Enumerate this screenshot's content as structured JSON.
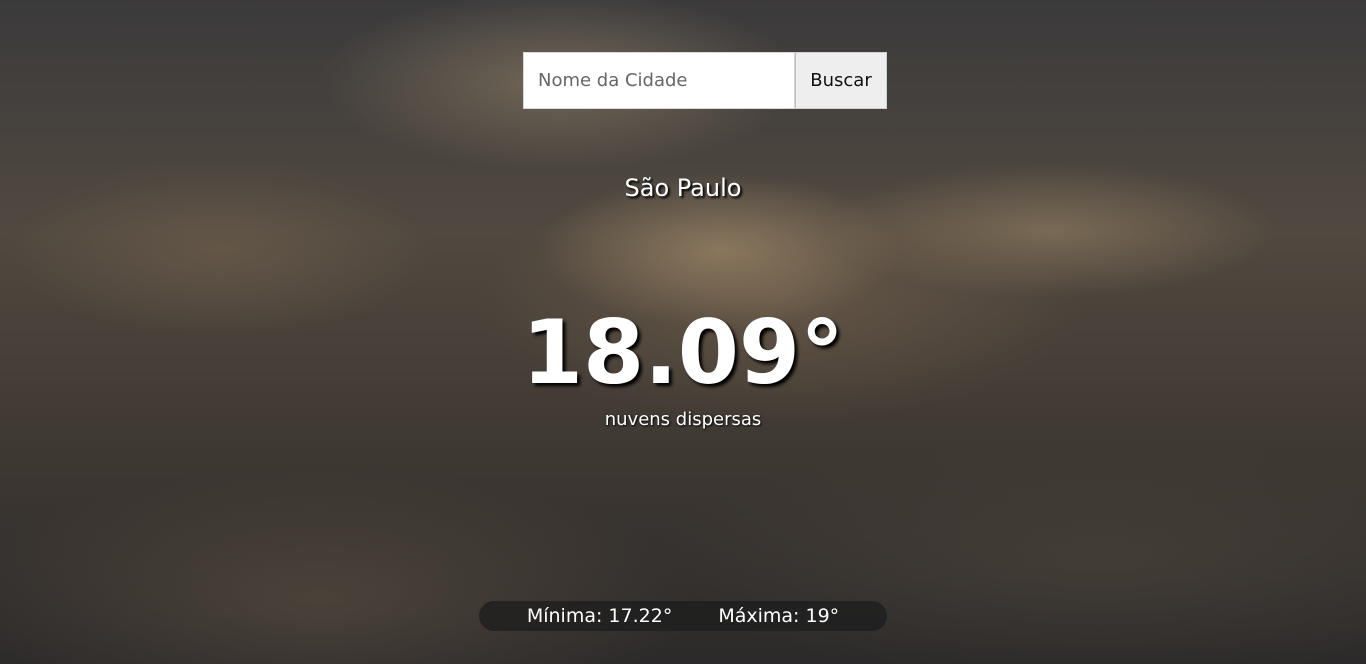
{
  "search": {
    "placeholder": "Nome da Cidade",
    "button_label": "Buscar"
  },
  "weather": {
    "city": "São Paulo",
    "temperature": "18.09°",
    "description": "nuvens dispersas",
    "min_label": "Mínima: 17.22°",
    "max_label": "Máxima: 19°"
  }
}
